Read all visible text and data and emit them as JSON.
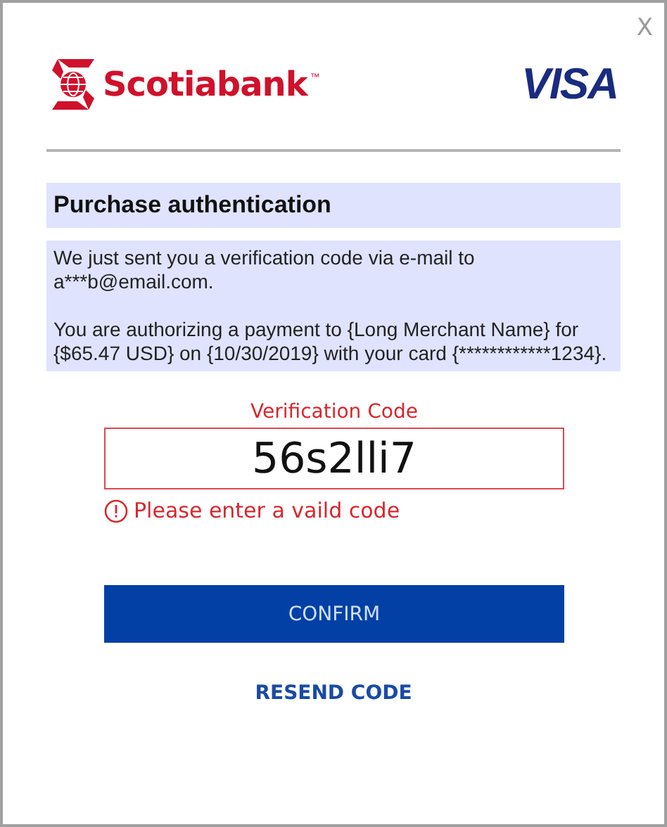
{
  "close_button": {
    "label": "X"
  },
  "header": {
    "bank_name": "Scotiabank",
    "trademark": "™",
    "card_brand": "VISA"
  },
  "title": "Purchase authentication",
  "message": [
    "We just sent you a verification code via e-mail to a***b@email.com.",
    "You are authorizing a payment to {Long Merchant Name} for {$65.47 USD} on {10/30/2019} with your card {************1234}."
  ],
  "code_field": {
    "label": "Verification Code",
    "value": "56s2lli7",
    "invalid": true,
    "error": "Please enter a vaild code"
  },
  "buttons": [
    {
      "label": "CONFIRM",
      "kind": "primary"
    },
    {
      "label": "RESEND CODE",
      "kind": "link"
    }
  ]
}
